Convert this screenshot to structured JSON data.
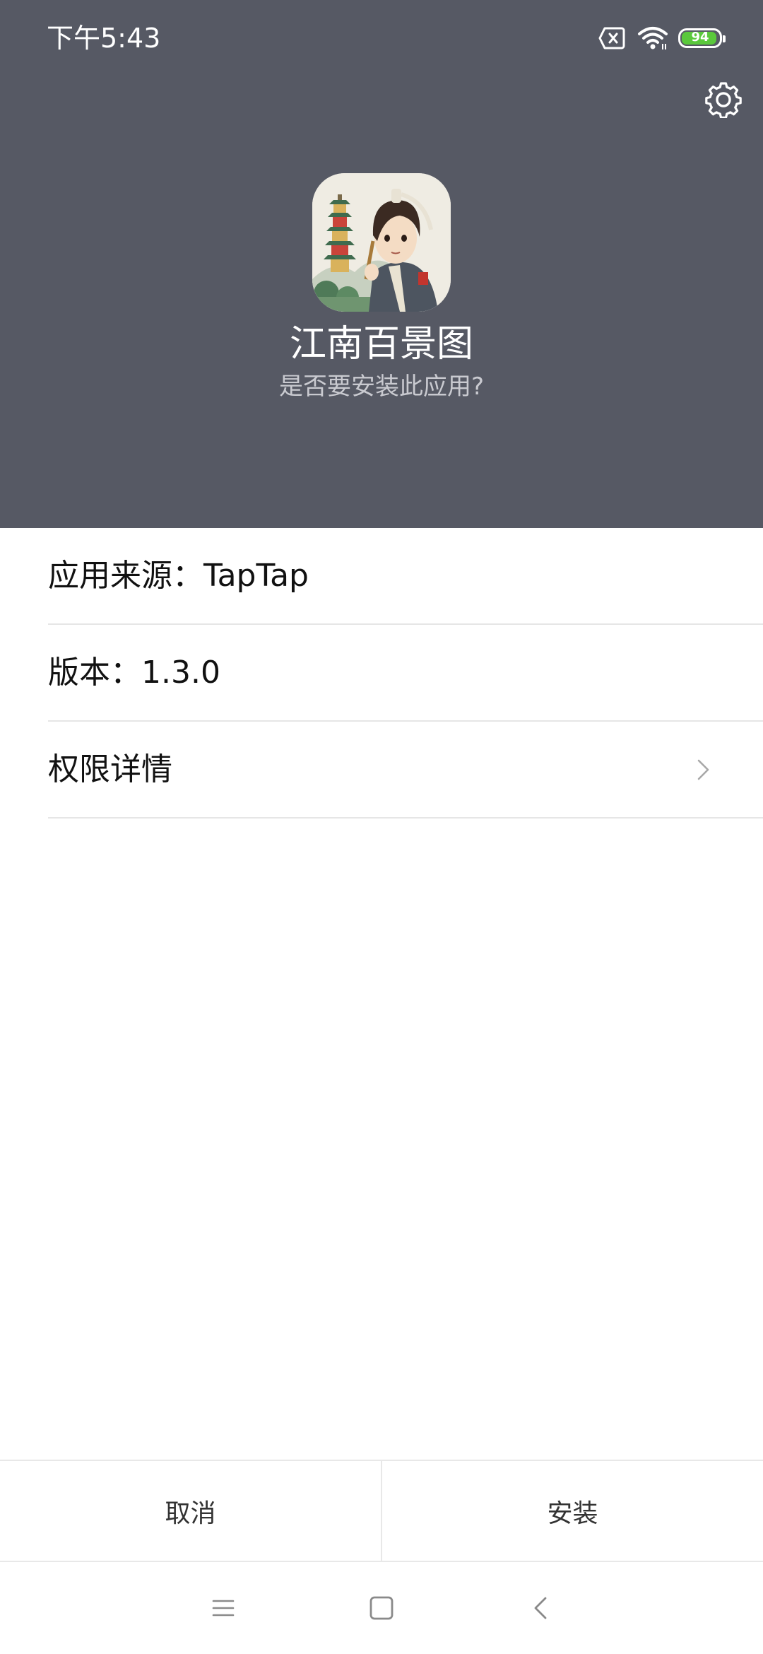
{
  "status_bar": {
    "time": "下午5:43",
    "battery_level": "94",
    "icons": [
      "sim-no-service-icon",
      "wifi-icon",
      "battery-icon"
    ]
  },
  "header": {
    "settings_icon": "gear-icon",
    "app_name": "江南百景图",
    "question": "是否要安装此应用?"
  },
  "info": {
    "source_label": "应用来源：",
    "source_value": "TapTap",
    "version_label": "版本：",
    "version_value": "1.3.0",
    "permissions_label": "权限详情"
  },
  "actions": {
    "cancel": "取消",
    "install": "安装"
  },
  "nav": {
    "items": [
      "menu-icon",
      "home-icon",
      "back-icon"
    ]
  },
  "colors": {
    "header_bg": "#565964",
    "battery_fill": "#5ac83c",
    "divider": "#e6e6e6"
  }
}
